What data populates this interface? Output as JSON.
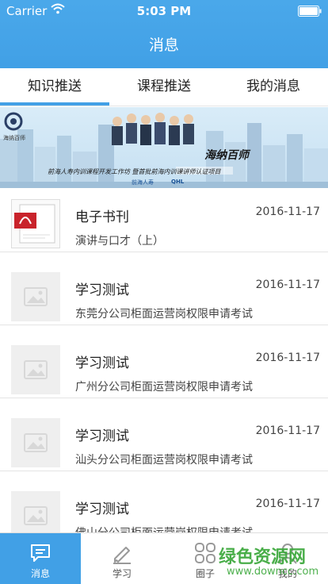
{
  "status": {
    "carrier": "Carrier",
    "time": "5:03 PM"
  },
  "nav": {
    "title": "消息"
  },
  "tabs": [
    {
      "label": "知识推送",
      "active": true
    },
    {
      "label": "课程推送",
      "active": false
    },
    {
      "label": "我的消息",
      "active": false
    }
  ],
  "banner": {
    "logo_text": "海纳百师",
    "title": "海纳百师",
    "subtitle": "前海人寿内训课程开发工作坊  暨首批前海内训课讲师认证项目",
    "brand_1": "前海人寿",
    "brand_2": "QHL"
  },
  "messages": [
    {
      "title": "电子书刊",
      "date": "2016-11-17",
      "subtitle": "演讲与口才（上）",
      "thumb": "pdf-icon"
    },
    {
      "title": "学习测试",
      "date": "2016-11-17",
      "subtitle": "东莞分公司柜面运营岗权限申请考试",
      "thumb": "image-placeholder-icon"
    },
    {
      "title": "学习测试",
      "date": "2016-11-17",
      "subtitle": "广州分公司柜面运营岗权限申请考试",
      "thumb": "image-placeholder-icon"
    },
    {
      "title": "学习测试",
      "date": "2016-11-17",
      "subtitle": "汕头分公司柜面运营岗权限申请考试",
      "thumb": "image-placeholder-icon"
    },
    {
      "title": "学习测试",
      "date": "2016-11-17",
      "subtitle": "佛山分公司柜面运营岗权限申请考试",
      "thumb": "image-placeholder-icon"
    }
  ],
  "tabbar": [
    {
      "label": "消息",
      "icon": "message-icon",
      "active": true
    },
    {
      "label": "学习",
      "icon": "edit-icon",
      "active": false
    },
    {
      "label": "圈子",
      "icon": "grid-icon",
      "active": false
    },
    {
      "label": "我的",
      "icon": "user-icon",
      "active": false
    }
  ],
  "watermark": {
    "main": "绿色资源网",
    "sub": "www.downcc.com"
  },
  "colors": {
    "accent": "#41a0e6",
    "watermark": "#3ba83b"
  }
}
